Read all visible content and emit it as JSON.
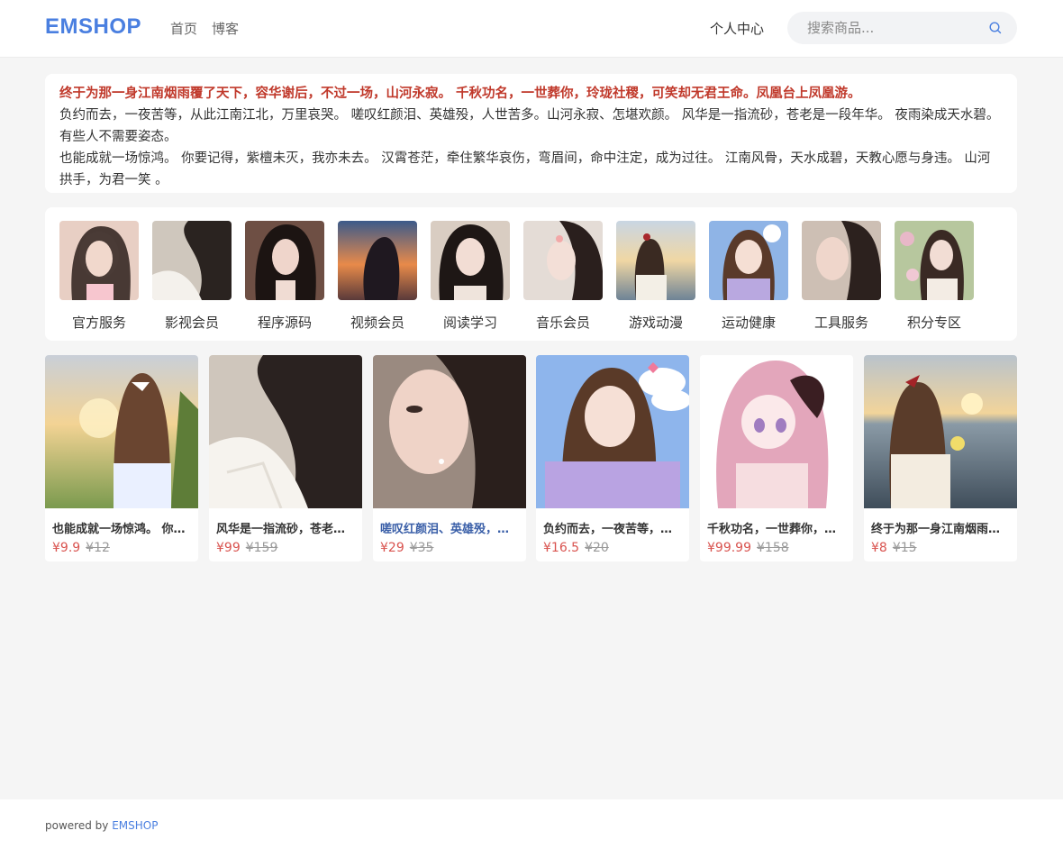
{
  "header": {
    "logo": "EMSHOP",
    "nav": [
      "首页",
      "博客"
    ],
    "user_center": "个人中心",
    "search_placeholder": "搜索商品..."
  },
  "notice": {
    "highlight": "终于为那一身江南烟雨覆了天下，容华谢后，不过一场，山河永寂。 千秋功名，一世葬你，玲珑社稷，可笑却无君王命。凤凰台上凤凰游。",
    "line2": "负约而去，一夜苦等，从此江南江北，万里哀哭。 嗟叹红颜泪、英雄殁，人世苦多。山河永寂、怎堪欢颜。 风华是一指流砂，苍老是一段年华。 夜雨染成天水碧。有些人不需要姿态。",
    "line3": "也能成就一场惊鸿。 你要记得，紫檀未灭，我亦未去。 汉霄苍茫，牵住繁华哀伤，弯眉间，命中注定，成为过往。 江南风骨，天水成碧，天教心愿与身违。 山河拱手，为君一笑 。"
  },
  "categories": [
    {
      "label": "官方服务"
    },
    {
      "label": "影视会员"
    },
    {
      "label": "程序源码"
    },
    {
      "label": "视频会员"
    },
    {
      "label": "阅读学习"
    },
    {
      "label": "音乐会员"
    },
    {
      "label": "游戏动漫"
    },
    {
      "label": "运动健康"
    },
    {
      "label": "工具服务"
    },
    {
      "label": "积分专区"
    }
  ],
  "products": [
    {
      "title": "也能成就一场惊鸿。 你要记得，紫檀未灭",
      "price": "¥9.9",
      "orig": "¥12"
    },
    {
      "title": "风华是一指流砂，苍老是一段年华",
      "price": "¥99",
      "orig": "¥159"
    },
    {
      "title": "嗟叹红颜泪、英雄殁，人世苦多",
      "price": "¥29",
      "orig": "¥35"
    },
    {
      "title": "负约而去，一夜苦等，从此江南江北",
      "price": "¥16.5",
      "orig": "¥20"
    },
    {
      "title": "千秋功名，一世葬你，玲珑社稷",
      "price": "¥99.99",
      "orig": "¥158"
    },
    {
      "title": "终于为那一身江南烟雨覆了天下",
      "price": "¥8",
      "orig": "¥15"
    }
  ],
  "footer": {
    "prefix": "powered by ",
    "brand": "EMSHOP"
  },
  "colors": {
    "brand": "#4a7fe0",
    "highlight": "#c0392b",
    "price": "#d9534f"
  }
}
